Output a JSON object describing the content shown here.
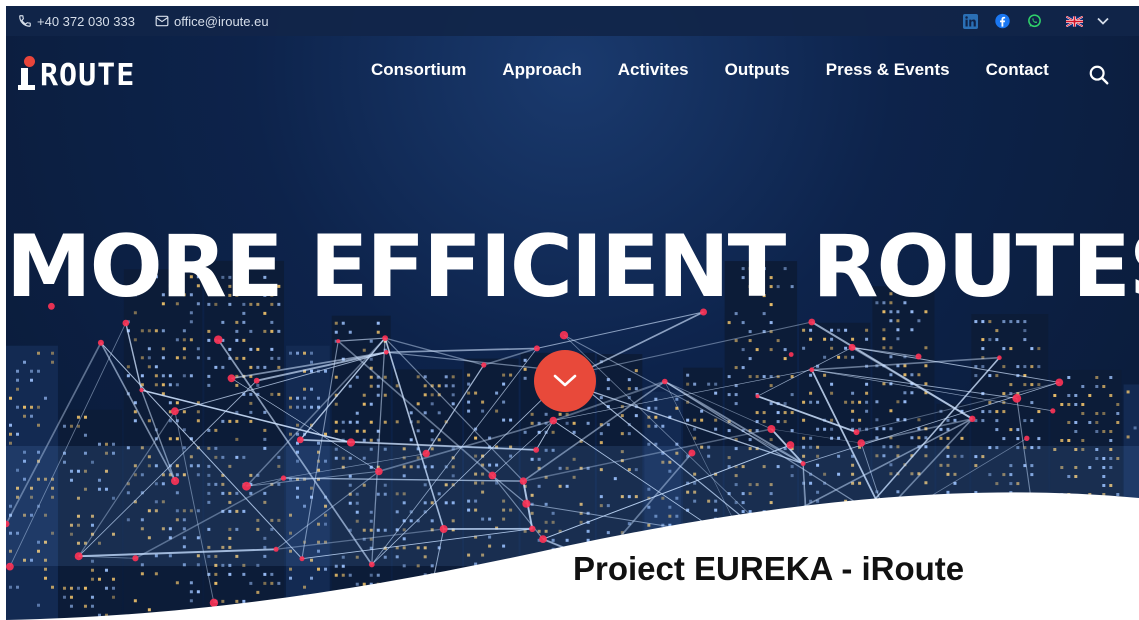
{
  "topbar": {
    "phone": "+40 372 030 333",
    "email": "office@iroute.eu",
    "socials": [
      "linkedin-icon",
      "facebook-icon",
      "whatsapp-icon"
    ],
    "language_flag": "uk-flag-icon"
  },
  "header": {
    "logo_text": "ROUTE",
    "nav": [
      "Consortium",
      "Approach",
      "Activites",
      "Outputs",
      "Press & Events",
      "Contact"
    ]
  },
  "hero": {
    "headline": "MORE EFFICIENT ROUTES.",
    "scroll_icon": "chevron-down-icon"
  },
  "caption": "Proiect EUREKA - iRoute",
  "colors": {
    "accent": "#e8493a",
    "topbar_bg": "#112549",
    "hero_bg": "#0d234b",
    "network_line": "#cfe3ff",
    "network_node": "#ff3355"
  }
}
